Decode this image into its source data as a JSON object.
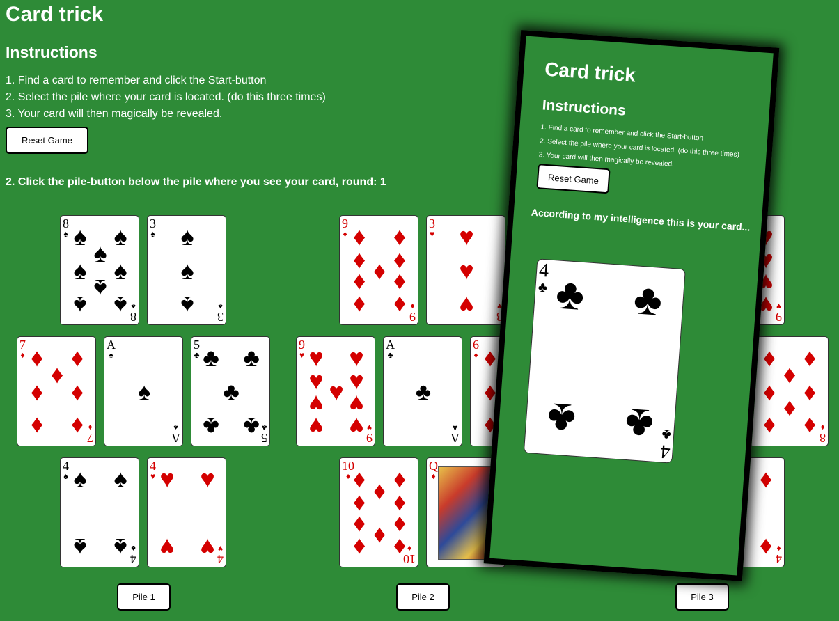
{
  "title": "Card trick",
  "instructions_heading": "Instructions",
  "steps": [
    "1. Find a card to remember and click the Start-button",
    "2. Select the pile where your card is located. (do this three times)",
    "3. Your card will then magically be revealed."
  ],
  "reset_label": "Reset Game",
  "round_text": "2. Click the pile-button below the pile where you see your card, round: 1",
  "piles": [
    {
      "button_label": "Pile 1",
      "cards": [
        {
          "rank": "8",
          "suit": "♠",
          "color": "black"
        },
        {
          "rank": "3",
          "suit": "♠",
          "color": "black"
        },
        {
          "rank": "7",
          "suit": "♦",
          "color": "red"
        },
        {
          "rank": "A",
          "suit": "♠",
          "color": "black"
        },
        {
          "rank": "5",
          "suit": "♣",
          "color": "black"
        },
        {
          "rank": "4",
          "suit": "♠",
          "color": "black"
        },
        {
          "rank": "4",
          "suit": "♥",
          "color": "red"
        }
      ]
    },
    {
      "button_label": "Pile 2",
      "cards": [
        {
          "rank": "9",
          "suit": "♦",
          "color": "red"
        },
        {
          "rank": "3",
          "suit": "♥",
          "color": "red"
        },
        {
          "rank": "9",
          "suit": "♥",
          "color": "red"
        },
        {
          "rank": "A",
          "suit": "♣",
          "color": "black"
        },
        {
          "rank": "6",
          "suit": "♦",
          "color": "red"
        },
        {
          "rank": "10",
          "suit": "♦",
          "color": "red"
        },
        {
          "rank": "Q",
          "suit": "♦",
          "color": "red"
        }
      ]
    },
    {
      "button_label": "Pile 3",
      "cards": [
        {
          "rank": "9",
          "suit": "♥",
          "color": "red"
        },
        {
          "rank": "8",
          "suit": "♦",
          "color": "red"
        },
        {
          "rank": "4",
          "suit": "♦",
          "color": "red"
        }
      ]
    }
  ],
  "overlay": {
    "title": "Card trick",
    "instructions_heading": "Instructions",
    "steps": [
      "1. Find a card to remember and click the Start-button",
      "2. Select the pile where your card is located. (do this three times)",
      "3. Your card will then magically be revealed."
    ],
    "reset_label": "Reset Game",
    "message": "According to my intelligence this is your card...",
    "revealed_card": {
      "rank": "4",
      "suit": "♣",
      "color": "black"
    }
  }
}
